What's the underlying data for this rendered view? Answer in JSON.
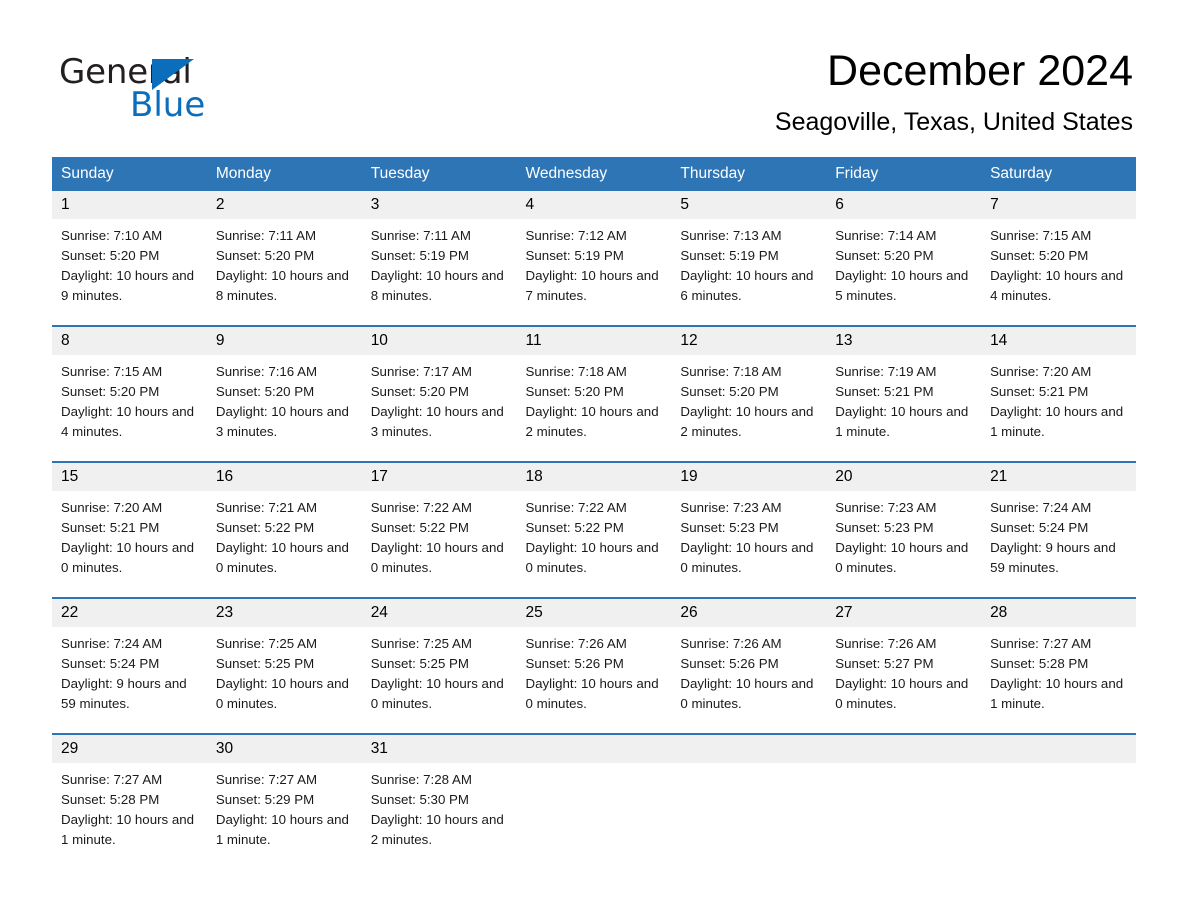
{
  "brand": {
    "name_part1": "General",
    "name_part2": "Blue",
    "accent_color": "#0a6ebd",
    "triangle_icon": "brand-triangle-icon"
  },
  "header": {
    "title": "December 2024",
    "subtitle": "Seagoville, Texas, United States"
  },
  "theme": {
    "header_blue": "#2e75b6",
    "daynum_band": "#f0f0f0",
    "divider_blue": "#2e75b6"
  },
  "weekday_headers": [
    "Sunday",
    "Monday",
    "Tuesday",
    "Wednesday",
    "Thursday",
    "Friday",
    "Saturday"
  ],
  "weeks": [
    [
      {
        "day": "1",
        "sunrise": "Sunrise: 7:10 AM",
        "sunset": "Sunset: 5:20 PM",
        "daylight": "Daylight: 10 hours and 9 minutes."
      },
      {
        "day": "2",
        "sunrise": "Sunrise: 7:11 AM",
        "sunset": "Sunset: 5:20 PM",
        "daylight": "Daylight: 10 hours and 8 minutes."
      },
      {
        "day": "3",
        "sunrise": "Sunrise: 7:11 AM",
        "sunset": "Sunset: 5:19 PM",
        "daylight": "Daylight: 10 hours and 8 minutes."
      },
      {
        "day": "4",
        "sunrise": "Sunrise: 7:12 AM",
        "sunset": "Sunset: 5:19 PM",
        "daylight": "Daylight: 10 hours and 7 minutes."
      },
      {
        "day": "5",
        "sunrise": "Sunrise: 7:13 AM",
        "sunset": "Sunset: 5:19 PM",
        "daylight": "Daylight: 10 hours and 6 minutes."
      },
      {
        "day": "6",
        "sunrise": "Sunrise: 7:14 AM",
        "sunset": "Sunset: 5:20 PM",
        "daylight": "Daylight: 10 hours and 5 minutes."
      },
      {
        "day": "7",
        "sunrise": "Sunrise: 7:15 AM",
        "sunset": "Sunset: 5:20 PM",
        "daylight": "Daylight: 10 hours and 4 minutes."
      }
    ],
    [
      {
        "day": "8",
        "sunrise": "Sunrise: 7:15 AM",
        "sunset": "Sunset: 5:20 PM",
        "daylight": "Daylight: 10 hours and 4 minutes."
      },
      {
        "day": "9",
        "sunrise": "Sunrise: 7:16 AM",
        "sunset": "Sunset: 5:20 PM",
        "daylight": "Daylight: 10 hours and 3 minutes."
      },
      {
        "day": "10",
        "sunrise": "Sunrise: 7:17 AM",
        "sunset": "Sunset: 5:20 PM",
        "daylight": "Daylight: 10 hours and 3 minutes."
      },
      {
        "day": "11",
        "sunrise": "Sunrise: 7:18 AM",
        "sunset": "Sunset: 5:20 PM",
        "daylight": "Daylight: 10 hours and 2 minutes."
      },
      {
        "day": "12",
        "sunrise": "Sunrise: 7:18 AM",
        "sunset": "Sunset: 5:20 PM",
        "daylight": "Daylight: 10 hours and 2 minutes."
      },
      {
        "day": "13",
        "sunrise": "Sunrise: 7:19 AM",
        "sunset": "Sunset: 5:21 PM",
        "daylight": "Daylight: 10 hours and 1 minute."
      },
      {
        "day": "14",
        "sunrise": "Sunrise: 7:20 AM",
        "sunset": "Sunset: 5:21 PM",
        "daylight": "Daylight: 10 hours and 1 minute."
      }
    ],
    [
      {
        "day": "15",
        "sunrise": "Sunrise: 7:20 AM",
        "sunset": "Sunset: 5:21 PM",
        "daylight": "Daylight: 10 hours and 0 minutes."
      },
      {
        "day": "16",
        "sunrise": "Sunrise: 7:21 AM",
        "sunset": "Sunset: 5:22 PM",
        "daylight": "Daylight: 10 hours and 0 minutes."
      },
      {
        "day": "17",
        "sunrise": "Sunrise: 7:22 AM",
        "sunset": "Sunset: 5:22 PM",
        "daylight": "Daylight: 10 hours and 0 minutes."
      },
      {
        "day": "18",
        "sunrise": "Sunrise: 7:22 AM",
        "sunset": "Sunset: 5:22 PM",
        "daylight": "Daylight: 10 hours and 0 minutes."
      },
      {
        "day": "19",
        "sunrise": "Sunrise: 7:23 AM",
        "sunset": "Sunset: 5:23 PM",
        "daylight": "Daylight: 10 hours and 0 minutes."
      },
      {
        "day": "20",
        "sunrise": "Sunrise: 7:23 AM",
        "sunset": "Sunset: 5:23 PM",
        "daylight": "Daylight: 10 hours and 0 minutes."
      },
      {
        "day": "21",
        "sunrise": "Sunrise: 7:24 AM",
        "sunset": "Sunset: 5:24 PM",
        "daylight": "Daylight: 9 hours and 59 minutes."
      }
    ],
    [
      {
        "day": "22",
        "sunrise": "Sunrise: 7:24 AM",
        "sunset": "Sunset: 5:24 PM",
        "daylight": "Daylight: 9 hours and 59 minutes."
      },
      {
        "day": "23",
        "sunrise": "Sunrise: 7:25 AM",
        "sunset": "Sunset: 5:25 PM",
        "daylight": "Daylight: 10 hours and 0 minutes."
      },
      {
        "day": "24",
        "sunrise": "Sunrise: 7:25 AM",
        "sunset": "Sunset: 5:25 PM",
        "daylight": "Daylight: 10 hours and 0 minutes."
      },
      {
        "day": "25",
        "sunrise": "Sunrise: 7:26 AM",
        "sunset": "Sunset: 5:26 PM",
        "daylight": "Daylight: 10 hours and 0 minutes."
      },
      {
        "day": "26",
        "sunrise": "Sunrise: 7:26 AM",
        "sunset": "Sunset: 5:26 PM",
        "daylight": "Daylight: 10 hours and 0 minutes."
      },
      {
        "day": "27",
        "sunrise": "Sunrise: 7:26 AM",
        "sunset": "Sunset: 5:27 PM",
        "daylight": "Daylight: 10 hours and 0 minutes."
      },
      {
        "day": "28",
        "sunrise": "Sunrise: 7:27 AM",
        "sunset": "Sunset: 5:28 PM",
        "daylight": "Daylight: 10 hours and 1 minute."
      }
    ],
    [
      {
        "day": "29",
        "sunrise": "Sunrise: 7:27 AM",
        "sunset": "Sunset: 5:28 PM",
        "daylight": "Daylight: 10 hours and 1 minute."
      },
      {
        "day": "30",
        "sunrise": "Sunrise: 7:27 AM",
        "sunset": "Sunset: 5:29 PM",
        "daylight": "Daylight: 10 hours and 1 minute."
      },
      {
        "day": "31",
        "sunrise": "Sunrise: 7:28 AM",
        "sunset": "Sunset: 5:30 PM",
        "daylight": "Daylight: 10 hours and 2 minutes."
      },
      {
        "day": "",
        "sunrise": "",
        "sunset": "",
        "daylight": ""
      },
      {
        "day": "",
        "sunrise": "",
        "sunset": "",
        "daylight": ""
      },
      {
        "day": "",
        "sunrise": "",
        "sunset": "",
        "daylight": ""
      },
      {
        "day": "",
        "sunrise": "",
        "sunset": "",
        "daylight": ""
      }
    ]
  ]
}
